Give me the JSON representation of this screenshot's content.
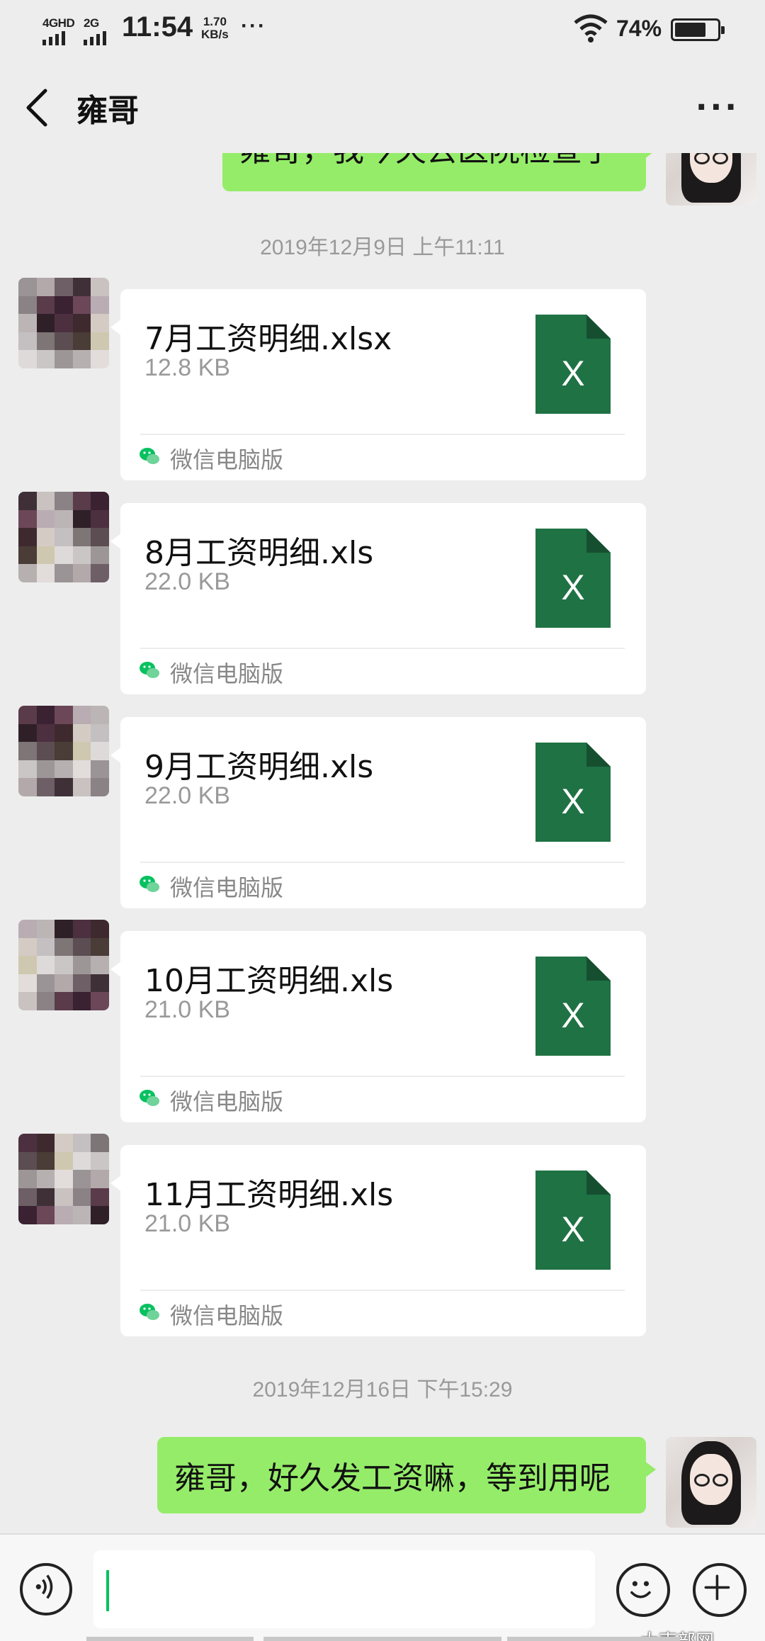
{
  "status_bar": {
    "sim1_label": "4GHD",
    "sim2_label": "2G",
    "time": "11:54",
    "speed_value": "1.70",
    "speed_unit": "KB/s",
    "more_dots": "···",
    "battery_percent": "74%",
    "battery_level": 0.74
  },
  "header": {
    "title": "雍哥",
    "back_icon": "chevron-left-icon",
    "more_label": "···"
  },
  "messages": {
    "partial_out_text": "雍哥，我今天去医院检查了",
    "timestamp_1": "2019年12月9日 上午11:11",
    "files": [
      {
        "name": "7月工资明细.xlsx",
        "size": "12.8 KB",
        "source": "微信电脑版"
      },
      {
        "name": "8月工资明细.xls",
        "size": "22.0 KB",
        "source": "微信电脑版"
      },
      {
        "name": "9月工资明细.xls",
        "size": "22.0 KB",
        "source": "微信电脑版"
      },
      {
        "name": "10月工资明细.xls",
        "size": "21.0 KB",
        "source": "微信电脑版"
      },
      {
        "name": "11月工资明细.xls",
        "size": "21.0 KB",
        "source": "微信电脑版"
      }
    ],
    "file_icon_letter": "X",
    "timestamp_2": "2019年12月16日 下午15:29",
    "last_out_text": "雍哥，好久发工资嘛，等到用呢"
  },
  "input_bar": {
    "voice_icon": "voice-icon",
    "emoji_icon": "emoji-icon",
    "plus_icon": "plus-icon"
  },
  "watermark": "大南部网",
  "colors": {
    "background": "#ededed",
    "outgoing_bubble": "#95ec69",
    "excel_green": "#1f7244",
    "wechat_green": "#07c160"
  }
}
